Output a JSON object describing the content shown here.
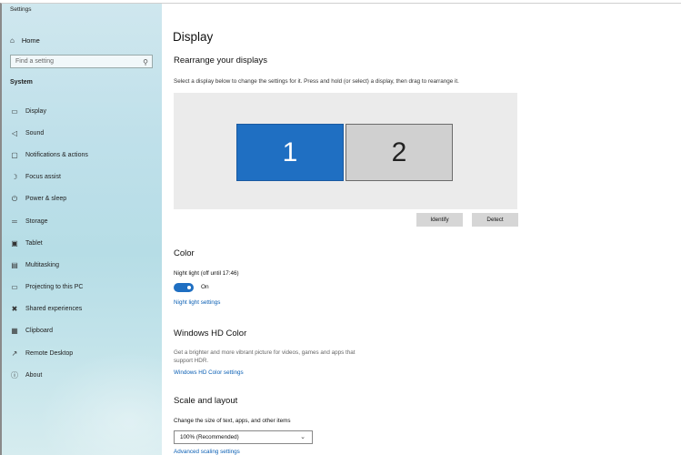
{
  "window": {
    "title": "Settings"
  },
  "sidebar": {
    "home": {
      "icon": "home-icon",
      "label": "Home"
    },
    "search": {
      "placeholder": "Find a setting",
      "icon": "search-icon"
    },
    "section": "System",
    "items": [
      {
        "label": "Display",
        "icon": "monitor-icon",
        "glyph": "▭"
      },
      {
        "label": "Sound",
        "icon": "speaker-icon",
        "glyph": "◁"
      },
      {
        "label": "Notifications & actions",
        "icon": "notification-icon",
        "glyph": "▢"
      },
      {
        "label": "Focus assist",
        "icon": "moon-icon",
        "glyph": "☽"
      },
      {
        "label": "Power & sleep",
        "icon": "power-icon",
        "glyph": "⏻"
      },
      {
        "label": "Storage",
        "icon": "storage-icon",
        "glyph": "═"
      },
      {
        "label": "Tablet",
        "icon": "tablet-icon",
        "glyph": "▣"
      },
      {
        "label": "Multitasking",
        "icon": "multitasking-icon",
        "glyph": "▤"
      },
      {
        "label": "Projecting to this PC",
        "icon": "projector-icon",
        "glyph": "▭"
      },
      {
        "label": "Shared experiences",
        "icon": "shared-icon",
        "glyph": "✖"
      },
      {
        "label": "Clipboard",
        "icon": "clipboard-icon",
        "glyph": "▦"
      },
      {
        "label": "Remote Desktop",
        "icon": "remote-icon",
        "glyph": "↗"
      },
      {
        "label": "About",
        "icon": "info-icon",
        "glyph": "ⓘ"
      }
    ]
  },
  "main": {
    "title": "Display",
    "rearrange": {
      "heading": "Rearrange your displays",
      "description": "Select a display below to change the settings for it. Press and hold (or select) a display, then drag to rearrange it.",
      "monitor1": "1",
      "monitor2": "2",
      "identify": "Identify",
      "detect": "Detect"
    },
    "color": {
      "heading": "Color",
      "night_light": "Night light (off until 17:46)",
      "toggle_state": "On",
      "settings_link": "Night light settings"
    },
    "hd_color": {
      "heading": "Windows HD Color",
      "description_line1": "Get a brighter and more vibrant picture for videos, games and apps that",
      "description_line2": "support HDR.",
      "settings_link": "Windows HD Color settings"
    },
    "scale": {
      "heading": "Scale and layout",
      "description": "Change the size of text, apps, and other items",
      "selected": "100% (Recommended)",
      "advanced_link": "Advanced scaling settings"
    }
  },
  "colors": {
    "accent": "#1f6fc2",
    "link": "#0a5fb4"
  }
}
